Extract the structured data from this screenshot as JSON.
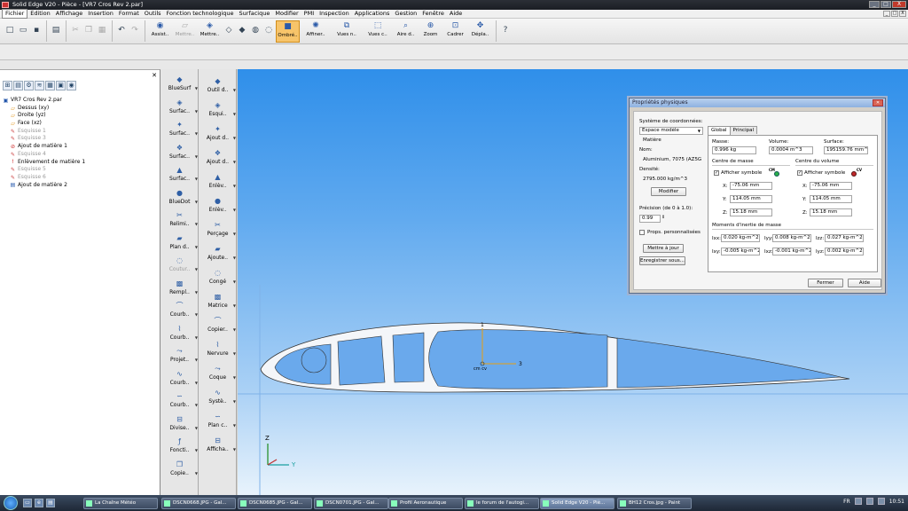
{
  "window": {
    "title": "Solid Edge V20 - Pièce - [VR7 Cros Rev 2.par]",
    "controls": [
      "_",
      "□",
      "X"
    ]
  },
  "menu": [
    "Fichier",
    "Edition",
    "Affichage",
    "Insertion",
    "Format",
    "Outils",
    "Fonction technologique",
    "Surfacique",
    "Modifier",
    "PMI",
    "Inspection",
    "Applications",
    "Gestion",
    "Fenêtre",
    "Aide"
  ],
  "toolbar": {
    "big_buttons": [
      {
        "label": "Assist..",
        "icon": "assistant-icon"
      },
      {
        "label": "Mettre..",
        "icon": "sketch-icon",
        "disabled": true
      },
      {
        "label": "Mettre..",
        "icon": "update-icon"
      },
      {
        "label": "Ombré..",
        "icon": "shaded-icon",
        "active": true
      },
      {
        "label": "Affiner..",
        "icon": "refine-icon"
      },
      {
        "label": "Vues n..",
        "icon": "named-views-icon"
      },
      {
        "label": "Vues c..",
        "icon": "common-views-icon"
      },
      {
        "label": "Aire d..",
        "icon": "area-icon"
      },
      {
        "label": "Zoom",
        "icon": "zoom-icon"
      },
      {
        "label": "Cadrer",
        "icon": "fit-icon"
      },
      {
        "label": "Dépla..",
        "icon": "pan-icon"
      }
    ]
  },
  "tree": [
    {
      "label": "VR7 Cros Rev 2.par",
      "icon": "part-icon",
      "indent": 0
    },
    {
      "label": "Dessus (xy)",
      "icon": "plane-icon",
      "indent": 1
    },
    {
      "label": "Droite (yz)",
      "icon": "plane-icon",
      "indent": 1
    },
    {
      "label": "Face (xz)",
      "icon": "plane-icon",
      "indent": 1
    },
    {
      "label": "Esquisse 1",
      "icon": "sketch-icon",
      "indent": 1,
      "grey": true
    },
    {
      "label": "Esquisse 3",
      "icon": "sketch-icon",
      "indent": 1,
      "grey": true
    },
    {
      "label": "Ajout de matière 1",
      "icon": "error-icon",
      "indent": 1
    },
    {
      "label": "Esquisse 4",
      "icon": "sketch-icon",
      "indent": 1,
      "grey": true
    },
    {
      "label": "Enlèvement de matière 1",
      "icon": "warning-icon",
      "indent": 1
    },
    {
      "label": "Esquisse 5",
      "icon": "sketch-icon",
      "indent": 1,
      "grey": true
    },
    {
      "label": "Esquisse 6",
      "icon": "sketch-icon",
      "indent": 1,
      "grey": true
    },
    {
      "label": "Ajout de matière 2",
      "icon": "protrusion-icon",
      "indent": 1
    }
  ],
  "commands_col1": [
    {
      "label": "BlueSurf"
    },
    {
      "label": "Surfac.."
    },
    {
      "label": "Surfac.."
    },
    {
      "label": "Surfac.."
    },
    {
      "label": "Surfac.."
    },
    {
      "label": "BlueDot"
    },
    {
      "label": "Relimi.."
    },
    {
      "label": "Plan d.."
    },
    {
      "label": "Coutur..",
      "disabled": true
    },
    {
      "label": "Rempl.."
    },
    {
      "label": "Courb.."
    },
    {
      "label": "Courb.."
    },
    {
      "label": "Projet.."
    },
    {
      "label": "Courb.."
    },
    {
      "label": "Courb.."
    },
    {
      "label": "Divise.."
    },
    {
      "label": "Foncti.."
    },
    {
      "label": "Copie.."
    }
  ],
  "commands_col2": [
    {
      "label": "Outil d.."
    },
    {
      "label": "Esqui.."
    },
    {
      "label": "Ajout d.."
    },
    {
      "label": "Ajout d.."
    },
    {
      "label": "Enlèv.."
    },
    {
      "label": "Enlèv.."
    },
    {
      "label": "Perçage"
    },
    {
      "label": "Ajoute.."
    },
    {
      "label": "Congé"
    },
    {
      "label": "Matrice"
    },
    {
      "label": "Copier.."
    },
    {
      "label": "Nervure"
    },
    {
      "label": "Coque"
    },
    {
      "label": "Systè.."
    },
    {
      "label": "Plan c.."
    },
    {
      "label": "Afficha.."
    }
  ],
  "viewport": {
    "axis_labels": {
      "z": "Z",
      "y": "Y",
      "feature_1": "1",
      "feature_3": "3",
      "cm_cv": "cm cv"
    }
  },
  "dialog": {
    "title": "Propriétés physiques",
    "coord_label": "Système de coordonnées:",
    "coord_value": "Espace modèle",
    "matiere_label": "Matière",
    "nom_label": "Nom:",
    "nom_value": "Aluminium, 7075 (AZ5G",
    "densite_label": "Densité:",
    "densite_value": "2795.000 kg/m^3",
    "modifier": "Modifier",
    "precision_label": "Précision (de 0 à 1.0):",
    "precision_value": "0.99",
    "props_label": "Props. personnalisées",
    "maj": "Mettre à jour",
    "save": "Enregistrer sous...",
    "tabs": [
      "Global",
      "Principal"
    ],
    "masse_label": "Masse:",
    "masse_value": "0.996 kg",
    "volume_label": "Volume:",
    "volume_value": "0.0004 m^3",
    "surface_label": "Surface:",
    "surface_value": "195159.76 mm^2",
    "cm_group": "Centre de masse",
    "cv_group": "Centre du volume",
    "show_symbol": "Afficher symbole",
    "cm_tag": "CM",
    "cv_tag": "CV",
    "cm": {
      "x": "-75.06 mm",
      "y": "114.05 mm",
      "z": "15.18 mm"
    },
    "cv": {
      "x": "-75.06 mm",
      "y": "114.05 mm",
      "z": "15.18 mm"
    },
    "axis_x": "X:",
    "axis_y": "Y:",
    "axis_z": "Z:",
    "inertia_group": "Moments d'inertie de masse",
    "ixx_label": "Ixx:",
    "ixx": "0.020 kg-m^2",
    "iyy_label": "Iyy:",
    "iyy": "0.008 kg-m^2",
    "izz_label": "Izz:",
    "izz": "0.027 kg-m^2",
    "ixy_label": "Ixy:",
    "ixy": "-0.005 kg-m^2",
    "ixz_label": "Ixz:",
    "ixz": "-0.001 kg-m^2",
    "iyz_label": "Iyz:",
    "iyz": "0.002 kg-m^2",
    "close": "Fermer",
    "help": "Aide"
  },
  "taskbar": {
    "tasks": [
      {
        "label": "La Chaîne Météo"
      },
      {
        "label": "DSCN0668.JPG - Gal..."
      },
      {
        "label": "DSCN0685.JPG - Gal..."
      },
      {
        "label": "DSCN0701.JPG - Gal..."
      },
      {
        "label": "Profil Aeronautique"
      },
      {
        "label": "le forum de l'autogi..."
      },
      {
        "label": "Solid Edge V20 - Piè...",
        "active": true
      },
      {
        "label": "BH12 Cros.jpg - Paint"
      }
    ],
    "lang": "FR",
    "clock": "10:51"
  }
}
